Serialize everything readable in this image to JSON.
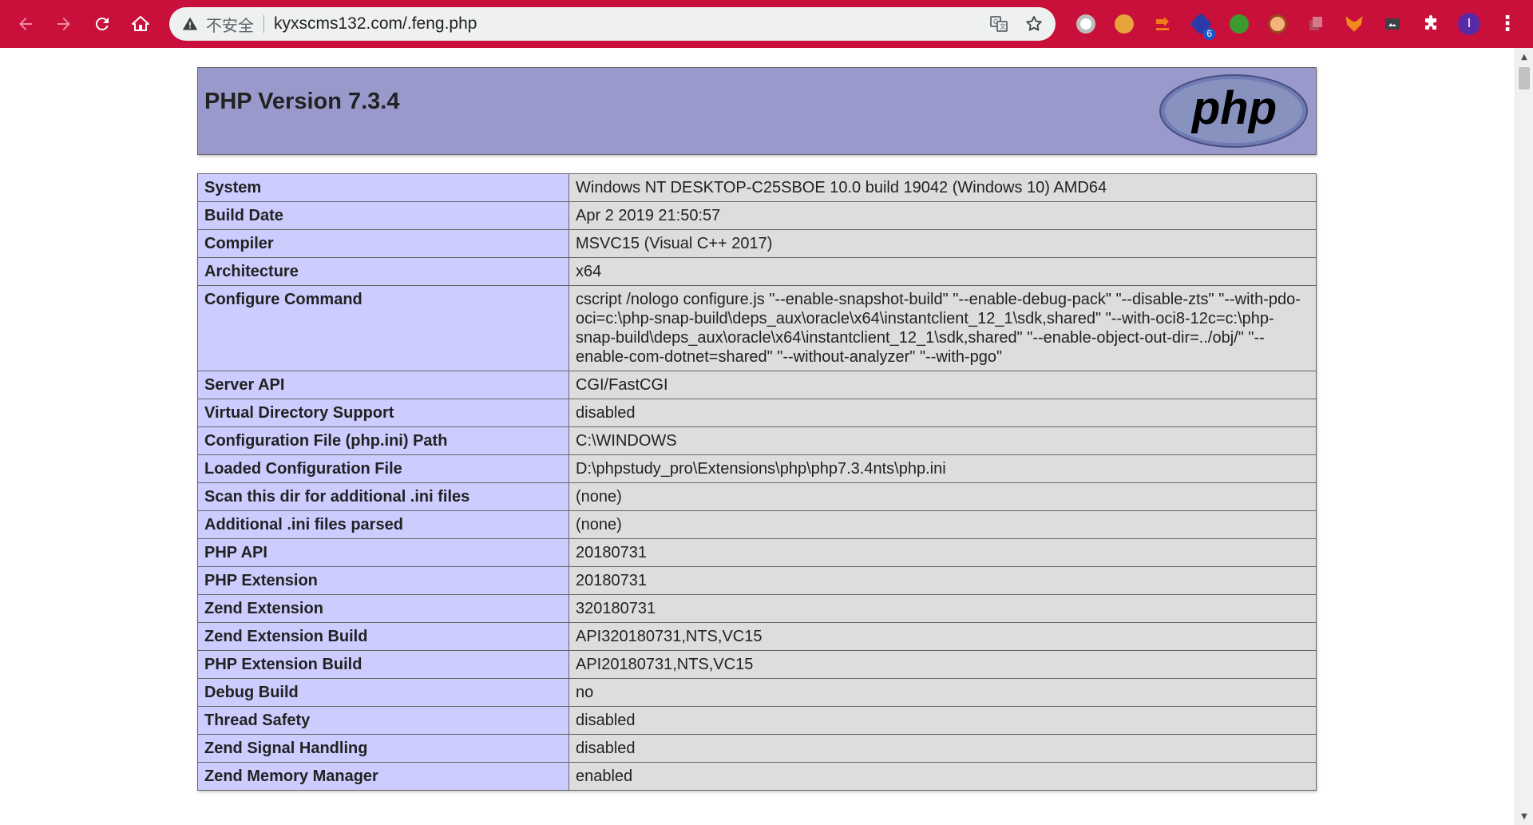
{
  "browser": {
    "security_label": "不安全",
    "url": "kyxscms132.com/.feng.php",
    "extension_badge": "6",
    "profile_initial": "I"
  },
  "page": {
    "php_title": "PHP Version 7.3.4",
    "logo_text": "php",
    "rows": [
      {
        "key": "System",
        "value": "Windows NT DESKTOP-C25SBOE 10.0 build 19042 (Windows 10) AMD64"
      },
      {
        "key": "Build Date",
        "value": "Apr 2 2019 21:50:57"
      },
      {
        "key": "Compiler",
        "value": "MSVC15 (Visual C++ 2017)"
      },
      {
        "key": "Architecture",
        "value": "x64"
      },
      {
        "key": "Configure Command",
        "value": "cscript /nologo configure.js \"--enable-snapshot-build\" \"--enable-debug-pack\" \"--disable-zts\" \"--with-pdo-oci=c:\\php-snap-build\\deps_aux\\oracle\\x64\\instantclient_12_1\\sdk,shared\" \"--with-oci8-12c=c:\\php-snap-build\\deps_aux\\oracle\\x64\\instantclient_12_1\\sdk,shared\" \"--enable-object-out-dir=../obj/\" \"--enable-com-dotnet=shared\" \"--without-analyzer\" \"--with-pgo\""
      },
      {
        "key": "Server API",
        "value": "CGI/FastCGI"
      },
      {
        "key": "Virtual Directory Support",
        "value": "disabled"
      },
      {
        "key": "Configuration File (php.ini) Path",
        "value": "C:\\WINDOWS"
      },
      {
        "key": "Loaded Configuration File",
        "value": "D:\\phpstudy_pro\\Extensions\\php\\php7.3.4nts\\php.ini"
      },
      {
        "key": "Scan this dir for additional .ini files",
        "value": "(none)"
      },
      {
        "key": "Additional .ini files parsed",
        "value": "(none)"
      },
      {
        "key": "PHP API",
        "value": "20180731"
      },
      {
        "key": "PHP Extension",
        "value": "20180731"
      },
      {
        "key": "Zend Extension",
        "value": "320180731"
      },
      {
        "key": "Zend Extension Build",
        "value": "API320180731,NTS,VC15"
      },
      {
        "key": "PHP Extension Build",
        "value": "API20180731,NTS,VC15"
      },
      {
        "key": "Debug Build",
        "value": "no"
      },
      {
        "key": "Thread Safety",
        "value": "disabled"
      },
      {
        "key": "Zend Signal Handling",
        "value": "disabled"
      },
      {
        "key": "Zend Memory Manager",
        "value": "enabled"
      }
    ]
  },
  "colors": {
    "chrome_bg": "#c8103a",
    "php_header_bg": "#9999cc",
    "key_cell_bg": "#ccccff",
    "value_cell_bg": "#dddddd"
  }
}
